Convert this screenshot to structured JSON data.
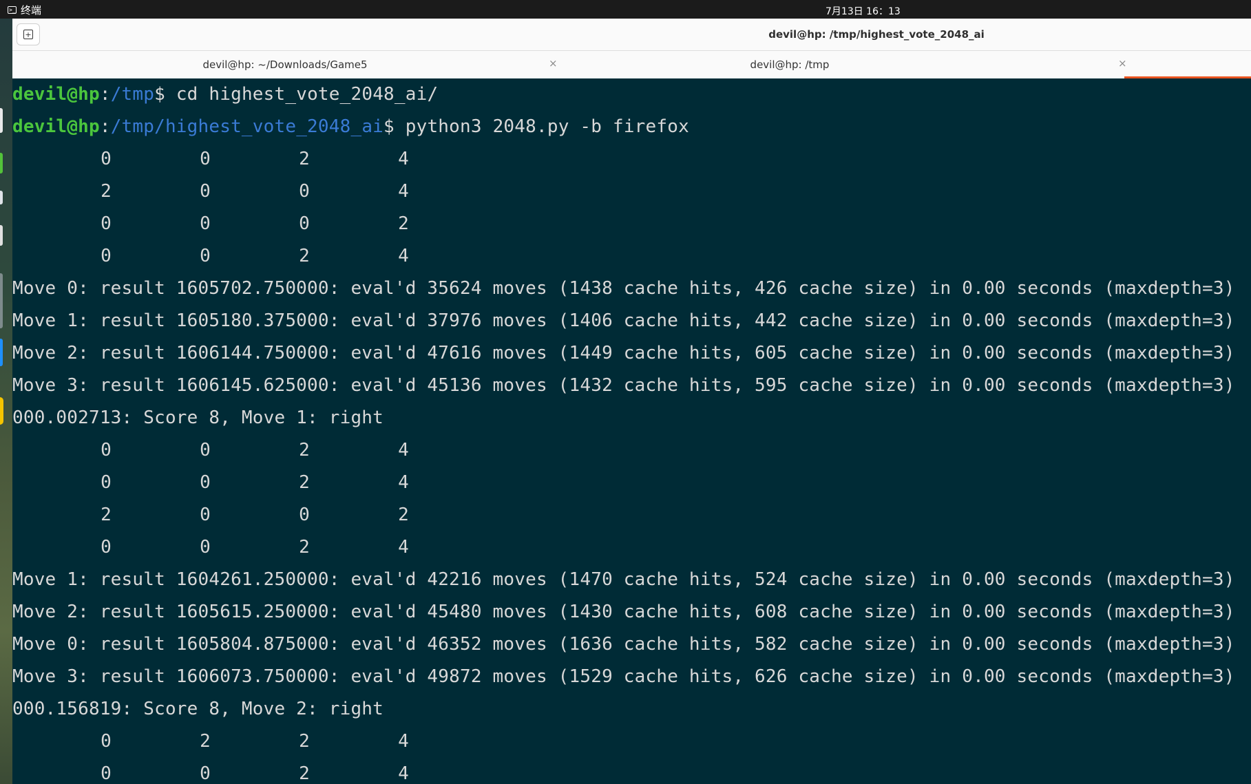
{
  "topbar": {
    "app_name": "终端",
    "clock": "7月13日 16：13"
  },
  "window": {
    "title": "devil@hp: /tmp/highest_vote_2048_ai"
  },
  "tabs": [
    {
      "label": "devil@hp: ~/Downloads/Game5",
      "close": "×"
    },
    {
      "label": "devil@hp: /tmp",
      "close": "×"
    }
  ],
  "terminal": {
    "prompt1": {
      "user": "devil@hp",
      "colon": ":",
      "path": "/tmp",
      "sigil": "$ ",
      "command": "cd highest_vote_2048_ai/"
    },
    "prompt2": {
      "user": "devil@hp",
      "colon": ":",
      "path": "/tmp/highest_vote_2048_ai",
      "sigil": "$ ",
      "command": "python3 2048.py -b firefox"
    },
    "board1": [
      [
        "0",
        "0",
        "2",
        "4"
      ],
      [
        "2",
        "0",
        "0",
        "4"
      ],
      [
        "0",
        "0",
        "0",
        "2"
      ],
      [
        "0",
        "0",
        "2",
        "4"
      ]
    ],
    "moves1": [
      "Move 0: result 1605702.750000: eval'd 35624 moves (1438 cache hits, 426 cache size) in 0.00 seconds (maxdepth=3)",
      "Move 1: result 1605180.375000: eval'd 37976 moves (1406 cache hits, 442 cache size) in 0.00 seconds (maxdepth=3)",
      "Move 2: result 1606144.750000: eval'd 47616 moves (1449 cache hits, 605 cache size) in 0.00 seconds (maxdepth=3)",
      "Move 3: result 1606145.625000: eval'd 45136 moves (1432 cache hits, 595 cache size) in 0.00 seconds (maxdepth=3)"
    ],
    "score1": "000.002713: Score 8, Move 1: right",
    "board2": [
      [
        "0",
        "0",
        "2",
        "4"
      ],
      [
        "0",
        "0",
        "2",
        "4"
      ],
      [
        "2",
        "0",
        "0",
        "2"
      ],
      [
        "0",
        "0",
        "2",
        "4"
      ]
    ],
    "moves2": [
      "Move 1: result 1604261.250000: eval'd 42216 moves (1470 cache hits, 524 cache size) in 0.00 seconds (maxdepth=3)",
      "Move 2: result 1605615.250000: eval'd 45480 moves (1430 cache hits, 608 cache size) in 0.00 seconds (maxdepth=3)",
      "Move 0: result 1605804.875000: eval'd 46352 moves (1636 cache hits, 582 cache size) in 0.00 seconds (maxdepth=3)",
      "Move 3: result 1606073.750000: eval'd 49872 moves (1529 cache hits, 626 cache size) in 0.00 seconds (maxdepth=3)"
    ],
    "score2": "000.156819: Score 8, Move 2: right",
    "board3": [
      [
        "0",
        "2",
        "2",
        "4"
      ],
      [
        "0",
        "0",
        "2",
        "4"
      ]
    ]
  },
  "colors": {
    "terminal_bg": "#002b36",
    "prompt_user": "#4bc63d",
    "prompt_path": "#3a7bd5",
    "active_tab_accent": "#e95420"
  },
  "icons": {
    "app_icon": "terminal-icon",
    "new_tab": "new-tab-icon",
    "tab_close": "close-icon"
  }
}
